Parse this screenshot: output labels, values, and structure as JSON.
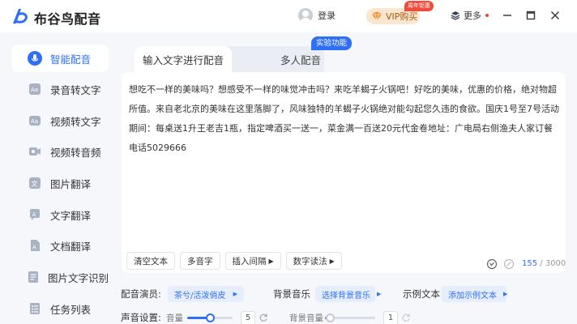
{
  "app": {
    "title": "布谷鸟配音"
  },
  "header": {
    "login_label": "登录",
    "vip_label": "VIP购买",
    "vip_badge": "周年钜惠",
    "more_label": "更多"
  },
  "sidebar": {
    "items": [
      {
        "label": "智能配音",
        "icon": "smart-dubbing-icon",
        "active": true
      },
      {
        "label": "录音转文字",
        "icon": "audio-to-text-icon"
      },
      {
        "label": "视频转文字",
        "icon": "video-to-text-icon"
      },
      {
        "label": "视频转音频",
        "icon": "video-to-audio-icon"
      },
      {
        "label": "图片翻译",
        "icon": "image-translate-icon"
      },
      {
        "label": "文字翻译",
        "icon": "text-translate-icon"
      },
      {
        "label": "文档翻译",
        "icon": "doc-translate-icon"
      },
      {
        "label": "图片文字识别",
        "icon": "ocr-icon"
      },
      {
        "label": "任务列表",
        "icon": "task-list-icon"
      }
    ]
  },
  "main": {
    "tabs": [
      {
        "label": "输入文字进行配音",
        "active": true
      },
      {
        "label": "多人配音"
      }
    ],
    "experimental_badge": "实验功能",
    "editor_text": "想吃不一样的美味吗？想感受不一样的味觉冲击吗？来吃羊蝎子火锅吧！好吃的美味，优惠的价格，绝对物超所值。来自老北京的美味在这里落脚了，风味独特的羊蝎子火锅绝对能勾起您久违的食欲。国庆1号至7号活动期间：每桌送1升王老吉1瓶，指定啤酒买一送一，菜金满一百送20元代金卷地址：广电局右侧渔夫人家订餐电话5029666",
    "tools": [
      {
        "label": "清空文本",
        "arrow": false
      },
      {
        "label": "多音字",
        "arrow": false
      },
      {
        "label": "插入间隔",
        "arrow": true
      },
      {
        "label": "数字读法",
        "arrow": true
      }
    ],
    "char_count": "155",
    "char_limit": "/ 3000",
    "voice": {
      "label": "配音演员:",
      "value": "茶兮/活泼俏皮"
    },
    "bgm": {
      "label": "背景音乐",
      "value": "选择背景音乐"
    },
    "sample": {
      "label": "示例文本",
      "value": "添加示例文本"
    },
    "sound": {
      "label": "声音设置:",
      "volume_label": "音量",
      "volume_value": "5",
      "volume_level": 0.5,
      "bg_volume_label": "背景音量",
      "bg_volume_value": "1",
      "bg_volume_level": 0.1
    }
  },
  "colors": {
    "accent": "#2f6ff5",
    "sidebar_bg": "#f5f7fb",
    "vip_bg": "#fbe6cf",
    "badge_red": "#f04b3a"
  }
}
